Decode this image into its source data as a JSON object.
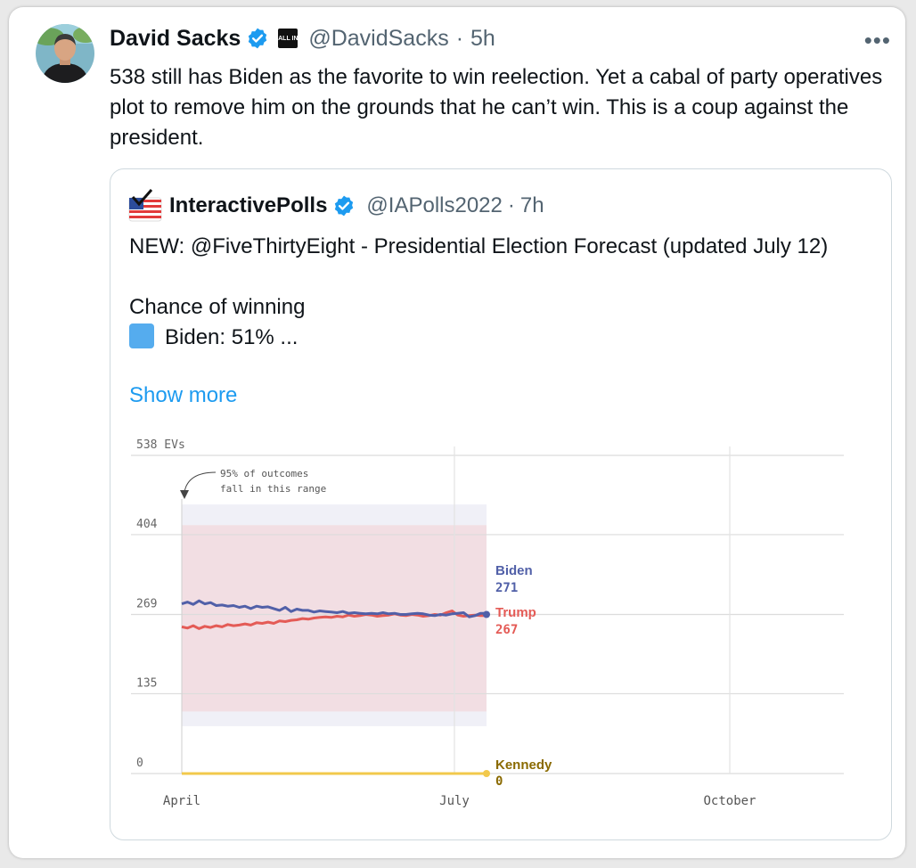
{
  "author": {
    "name": "David Sacks",
    "handle": "@DavidSacks",
    "time": "5h",
    "affiliation_badge": "ALL IN",
    "verified_icon": "verified-badge-icon"
  },
  "tweet_text": "538 still has Biden as the favorite to win reelection. Yet a cabal of party operatives plot to remove him on the grounds that he can’t win. This is a coup against the president.",
  "more_icon": "more-dots-icon",
  "quote": {
    "name": "InteractivePolls",
    "handle": "@IAPolls2022",
    "time": "7h",
    "line1": "NEW: @FiveThirtyEight - Presidential Election Forecast (updated July 12)",
    "line2": "Chance of winning",
    "line3": "Biden: 51% ...",
    "show_more": "Show more"
  },
  "colors": {
    "biden": "#5160a8",
    "trump": "#e45b56",
    "kennedy": "#8a6a00",
    "kennedy_line": "#f2c94c",
    "link": "#1d9bf0"
  },
  "chart_data": {
    "type": "line",
    "yticks": [
      {
        "v": 0,
        "label": "0"
      },
      {
        "v": 135,
        "label": "135"
      },
      {
        "v": 269,
        "label": "269"
      },
      {
        "v": 404,
        "label": "404"
      },
      {
        "v": 538,
        "label": "538 EVs"
      }
    ],
    "xticks": [
      "April",
      "July",
      "October"
    ],
    "annotation": [
      "95% of outcomes",
      "fall in this range"
    ],
    "series": [
      {
        "name": "Biden",
        "final": "271",
        "values": [
          287,
          290,
          286,
          292,
          287,
          289,
          284,
          285,
          283,
          284,
          281,
          283,
          279,
          283,
          281,
          282,
          279,
          276,
          281,
          274,
          278,
          276,
          276,
          273,
          275,
          274,
          273,
          272,
          274,
          271,
          272,
          271,
          270,
          271,
          270,
          272,
          270,
          271,
          269,
          269,
          270,
          271,
          270,
          268,
          267,
          269,
          268,
          270,
          271,
          272,
          265,
          267,
          271,
          271
        ]
      },
      {
        "name": "Trump",
        "final": "267",
        "values": [
          248,
          246,
          250,
          245,
          249,
          247,
          250,
          248,
          252,
          250,
          251,
          253,
          251,
          255,
          254,
          256,
          254,
          258,
          257,
          259,
          260,
          262,
          261,
          263,
          264,
          265,
          264,
          266,
          265,
          268,
          266,
          267,
          269,
          268,
          266,
          267,
          268,
          270,
          268,
          267,
          269,
          268,
          266,
          267,
          269,
          268,
          272,
          275,
          268,
          266,
          267,
          268,
          267,
          267
        ]
      },
      {
        "name": "Kennedy",
        "final": "0",
        "values": [
          0,
          0
        ]
      }
    ]
  }
}
